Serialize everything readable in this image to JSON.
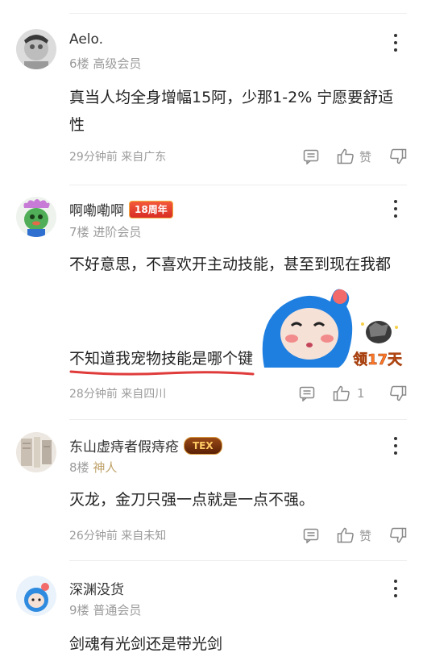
{
  "comments": [
    {
      "username": "Aelo.",
      "floor": "6楼",
      "level": "高级会员",
      "text": "真当人均全身增幅15阿，少那1-2% 宁愿要舒适性",
      "time": "29分钟前 来自广东",
      "like_label": "赞"
    },
    {
      "username": "啊嘞嘞啊",
      "badge": "18周年",
      "floor": "7楼",
      "level": "进阶会员",
      "text_line1": "不好意思，不喜欢开主动技能，甚至到现在我都",
      "text_line2": "不知道我宠物技能是哪个键",
      "time": "28分钟前 来自四川",
      "like_count": "1",
      "promo_label": "领17天"
    },
    {
      "username": "东山虚痔者假痔疮",
      "badge": "TEX",
      "floor": "8楼",
      "level": "神人",
      "text": "灭龙，金刀只强一点就是一点不强。",
      "time": "26分钟前 来自未知",
      "like_label": "赞"
    },
    {
      "username": "深渊没货",
      "floor": "9楼",
      "level": "普通会员",
      "text": "剑魂有光剑还是带光剑"
    }
  ],
  "colors": {
    "text": "#222222",
    "meta": "#9b9b9b",
    "special_level": "#c0a36c",
    "underline": "#e03b3b"
  }
}
